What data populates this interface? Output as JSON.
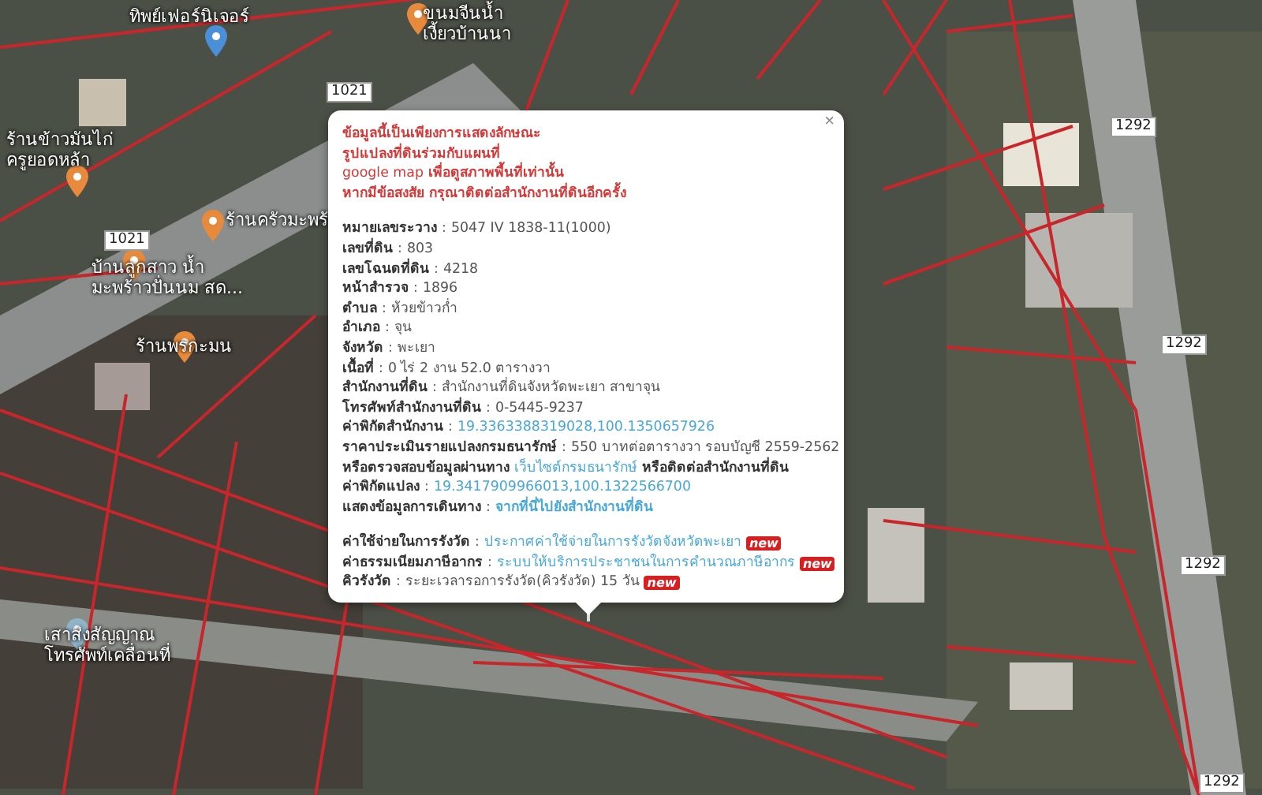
{
  "map": {
    "places": [
      {
        "name": "ทิพย์เฟอร์นิเจอร์",
        "color": "#4a8fd8"
      },
      {
        "name": "ขนมจีนน้ำ\nเงี้ยวบ้านนา",
        "color": "#e88a3c"
      },
      {
        "name": "ร้านข้าวมันไก่\nครูยอดหล้า",
        "color": "#e88a3c"
      },
      {
        "name": "ร้านครัวมะพร้",
        "color": "#e88a3c"
      },
      {
        "name": "บ้านลูกสาว น้ำ\nมะพร้าวปั่นนม สด...",
        "color": "#e88a3c"
      },
      {
        "name": "ร้านพรกะมน",
        "color": "#e88a3c"
      },
      {
        "name": "เสาส่งสัญญาณ\nโทรศัพท์เคลื่อนที่",
        "color": "#8fb3c8"
      }
    ],
    "road_shields": [
      "1021",
      "1021",
      "1292",
      "1292",
      "1292",
      "1292"
    ]
  },
  "popup": {
    "close": "×",
    "notice": [
      "ข้อมูลนี้เป็นเพียงการแสดงลักษณะ",
      "รูปแปลงที่ดินร่วมกับแผนที่",
      "google map **เพื่อดูสภาพพื้นที่เท่านั้น**",
      "หากมีข้อสงสัย กรุณาติดต่อสำนักงานที่ดินอีกครั้ง"
    ],
    "rows": [
      {
        "label": "หมายเลขระวาง",
        "sep": ":",
        "parts": [
          {
            "kind": "value",
            "text": "5047 IV 1838-11(1000)"
          }
        ]
      },
      {
        "label": "เลขที่ดิน",
        "sep": ":",
        "parts": [
          {
            "kind": "value",
            "text": "803"
          }
        ]
      },
      {
        "label": "เลขโฉนดที่ดิน",
        "sep": ":",
        "parts": [
          {
            "kind": "value",
            "text": "4218"
          }
        ]
      },
      {
        "label": "หน้าสำรวจ",
        "sep": ":",
        "parts": [
          {
            "kind": "value",
            "text": "1896"
          }
        ]
      },
      {
        "label": "ตำบล",
        "sep": ":",
        "parts": [
          {
            "kind": "value",
            "text": "ห้วยข้าวก่ำ"
          }
        ]
      },
      {
        "label": "อำเภอ",
        "sep": ":",
        "parts": [
          {
            "kind": "value",
            "text": "จุน"
          }
        ]
      },
      {
        "label": "จังหวัด",
        "sep": ":",
        "parts": [
          {
            "kind": "value",
            "text": "พะเยา"
          }
        ]
      },
      {
        "label": "เนื้อที่",
        "sep": ":",
        "parts": [
          {
            "kind": "value",
            "text": "0 ไร่ 2 งาน 52.0 ตารางวา"
          }
        ]
      },
      {
        "label": "สำนักงานที่ดิน",
        "sep": ":",
        "parts": [
          {
            "kind": "value",
            "text": "สำนักงานที่ดินจังหวัดพะเยา สาขาจุน"
          }
        ]
      },
      {
        "label": "โทรศัพท์สำนักงานที่ดิน",
        "sep": ":",
        "parts": [
          {
            "kind": "value",
            "text": "0-5445-9237"
          }
        ]
      },
      {
        "label": "ค่าพิกัดสำนักงาน",
        "sep": ":",
        "parts": [
          {
            "kind": "link",
            "text": "19.3363388319028,100.1350657926"
          }
        ]
      },
      {
        "label": "ราคาประเมินรายแปลงกรมธนารักษ์",
        "sep": ":",
        "parts": [
          {
            "kind": "value",
            "text": "550 บาทต่อตารางวา รอบบัญชี 2559-2562"
          }
        ]
      },
      {
        "parts": [
          {
            "kind": "text",
            "text": "หรือตรวจสอบข้อมูลผ่านทาง"
          },
          {
            "kind": "link",
            "text": "เว็บไซต์กรมธนารักษ์"
          },
          {
            "kind": "text",
            "text": "หรือติดต่อสำนักงานที่ดิน"
          }
        ]
      },
      {
        "label": "ค่าพิกัดแปลง",
        "sep": ":",
        "parts": [
          {
            "kind": "link",
            "text": "19.3417909966013,100.1322566700"
          }
        ]
      },
      {
        "label": "แสดงข้อมูลการเดินทาง",
        "sep": ":",
        "parts": [
          {
            "kind": "strong-link",
            "text": "จากที่นี่ไปยังสำนักงานที่ดิน"
          }
        ]
      },
      {
        "parts": [
          {
            "kind": "spacer"
          }
        ]
      },
      {
        "label": "ค่าใช้จ่ายในการรังวัด",
        "sep": ":",
        "parts": [
          {
            "kind": "link",
            "text": "ประกาศค่าใช้จ่ายในการรังวัดจังหวัดพะเยา"
          },
          {
            "kind": "badge",
            "text": "new"
          }
        ]
      },
      {
        "label": "ค่าธรรมเนียมภาษีอากร",
        "sep": ":",
        "parts": [
          {
            "kind": "link",
            "text": "ระบบให้บริการประชาชนในการคำนวณภาษีอากร"
          },
          {
            "kind": "badge",
            "text": "new"
          }
        ]
      },
      {
        "label": "คิวรังวัด",
        "sep": ":",
        "parts": [
          {
            "kind": "value",
            "text": "ระยะเวลารอการรังวัด(คิวรังวัด) 15 วัน"
          },
          {
            "kind": "badge",
            "text": "new"
          }
        ]
      }
    ]
  }
}
